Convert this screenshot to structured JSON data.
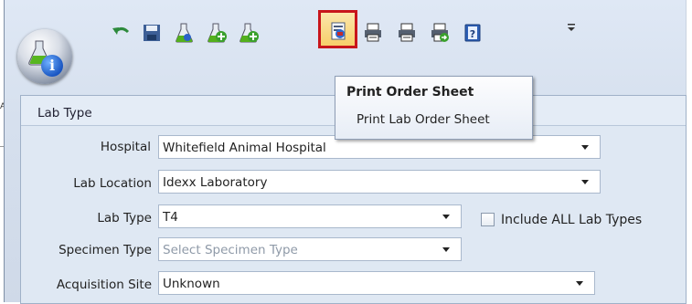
{
  "toolbar": {
    "icons": [
      "undo-icon",
      "save-icon",
      "lab-flask-icon",
      "add-lab-icon",
      "add-lab-2-icon",
      "print-order-sheet-icon",
      "print-icon",
      "print-2-icon",
      "print-go-icon",
      "help-icon",
      "overflow-icon"
    ],
    "selected_icon": "print-order-sheet-icon"
  },
  "tooltip": {
    "title": "Print Order Sheet",
    "body": "Print Lab Order Sheet"
  },
  "panel": {
    "title": "Lab Type"
  },
  "form": {
    "hospital": {
      "label": "Hospital",
      "value": "Whitefield Animal Hospital"
    },
    "lab_location": {
      "label": "Lab Location",
      "value": "Idexx Laboratory"
    },
    "lab_type": {
      "label": "Lab Type",
      "value": "T4"
    },
    "include_all": {
      "label": "Include ALL Lab Types",
      "checked": false
    },
    "specimen_type": {
      "label": "Specimen Type",
      "placeholder": "Select Specimen Type"
    },
    "acquisition_site": {
      "label": "Acquisition Site",
      "value": "Unknown"
    }
  },
  "colors": {
    "highlight_border": "#c8151b",
    "panel_bg": "#dfe8f3"
  }
}
